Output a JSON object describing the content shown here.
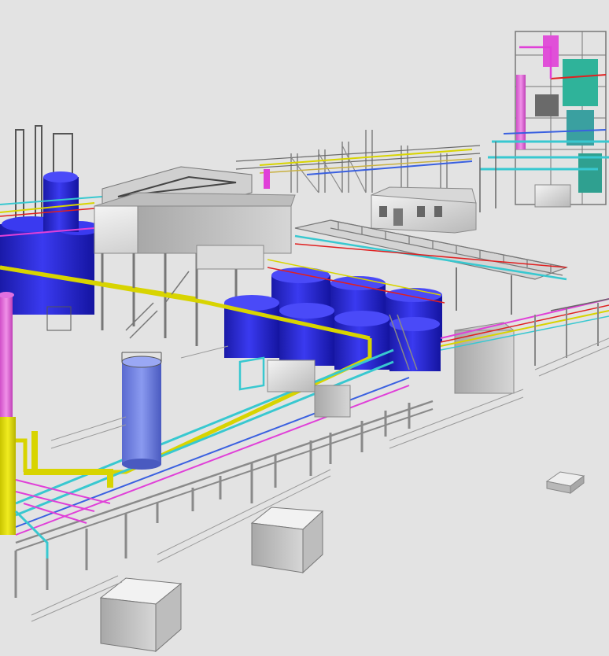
{
  "view": {
    "kind": "3d-plant-model-viewport",
    "colors": {
      "background": "#e4e4e4",
      "ground": "#e2e2e2",
      "steel": "#8a8a8a",
      "steel_dark": "#5f5f5f",
      "concrete": "#cfcfcf",
      "tank_blue": "#2a2ad6",
      "tank_blue_dark": "#1818a0",
      "pipe_yellow": "#d8d400",
      "pipe_cyan": "#38c8d0",
      "pipe_magenta": "#e040d8",
      "pipe_red": "#e02020",
      "pipe_blue": "#3a60e0",
      "equipment_teal": "#2fb39a"
    }
  }
}
